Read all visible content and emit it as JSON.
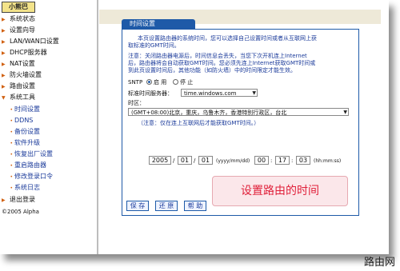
{
  "logo_text": "小熊巴",
  "sidebar": {
    "items": [
      {
        "label": "系统状态"
      },
      {
        "label": "设置向导"
      },
      {
        "label": "LAN/WAN口设置"
      },
      {
        "label": "DHCP服务器"
      },
      {
        "label": "NAT设置"
      },
      {
        "label": "防火墙设置"
      },
      {
        "label": "路由设置"
      },
      {
        "label": "系统工具"
      }
    ],
    "subitems": [
      {
        "label": "时间设置"
      },
      {
        "label": "DDNS"
      },
      {
        "label": "备份设置"
      },
      {
        "label": "软件升级"
      },
      {
        "label": "恢复出厂设置"
      },
      {
        "label": "重启路由器"
      },
      {
        "label": "修改登录口令"
      },
      {
        "label": "系统日志"
      }
    ],
    "logout": "退出登录",
    "copyright": "©2005 Alpha"
  },
  "panel": {
    "title": "时间设置",
    "intro_line1": "本页设置路由器的系统时间，您可以选择自己设置时间或者从互联网上获",
    "intro_line2": "取标准的GMT时间。",
    "note_line1": "注意：关闭路由器电源后，时间信息会丢失，当您下次开机连上Internet",
    "note_line2": "后，路由器将会自动获取GMT时间。您必须先连上Internet获取GMT时间或",
    "note_line3": "到此页设置时间后，其他功能（如防火墙）中的时间限定才能生效。",
    "sntp_label": "SNTP",
    "sntp_on": "启 用",
    "sntp_off": "停 止",
    "server_label": "标准时间服务器：",
    "server_value": "time.windows.com",
    "tz_label": "时区：",
    "tz_value": "(GMT+08:00)北京，重庆，乌鲁木齐，香港特别行政区，台北",
    "tz_note": "（注意：仅在连上互联网后才能获取GMT时间。）",
    "date": {
      "year": "2005",
      "month": "01",
      "day": "01",
      "format": "(yyyy/mm/dd)"
    },
    "time": {
      "hour": "00",
      "minute": "17",
      "second": "03",
      "format": "(hh:mm:ss)"
    },
    "buttons": {
      "save": "保 存",
      "restore": "还 原",
      "help": "帮 助"
    }
  },
  "callout": "设置路由的时间",
  "watermark": "路由网"
}
